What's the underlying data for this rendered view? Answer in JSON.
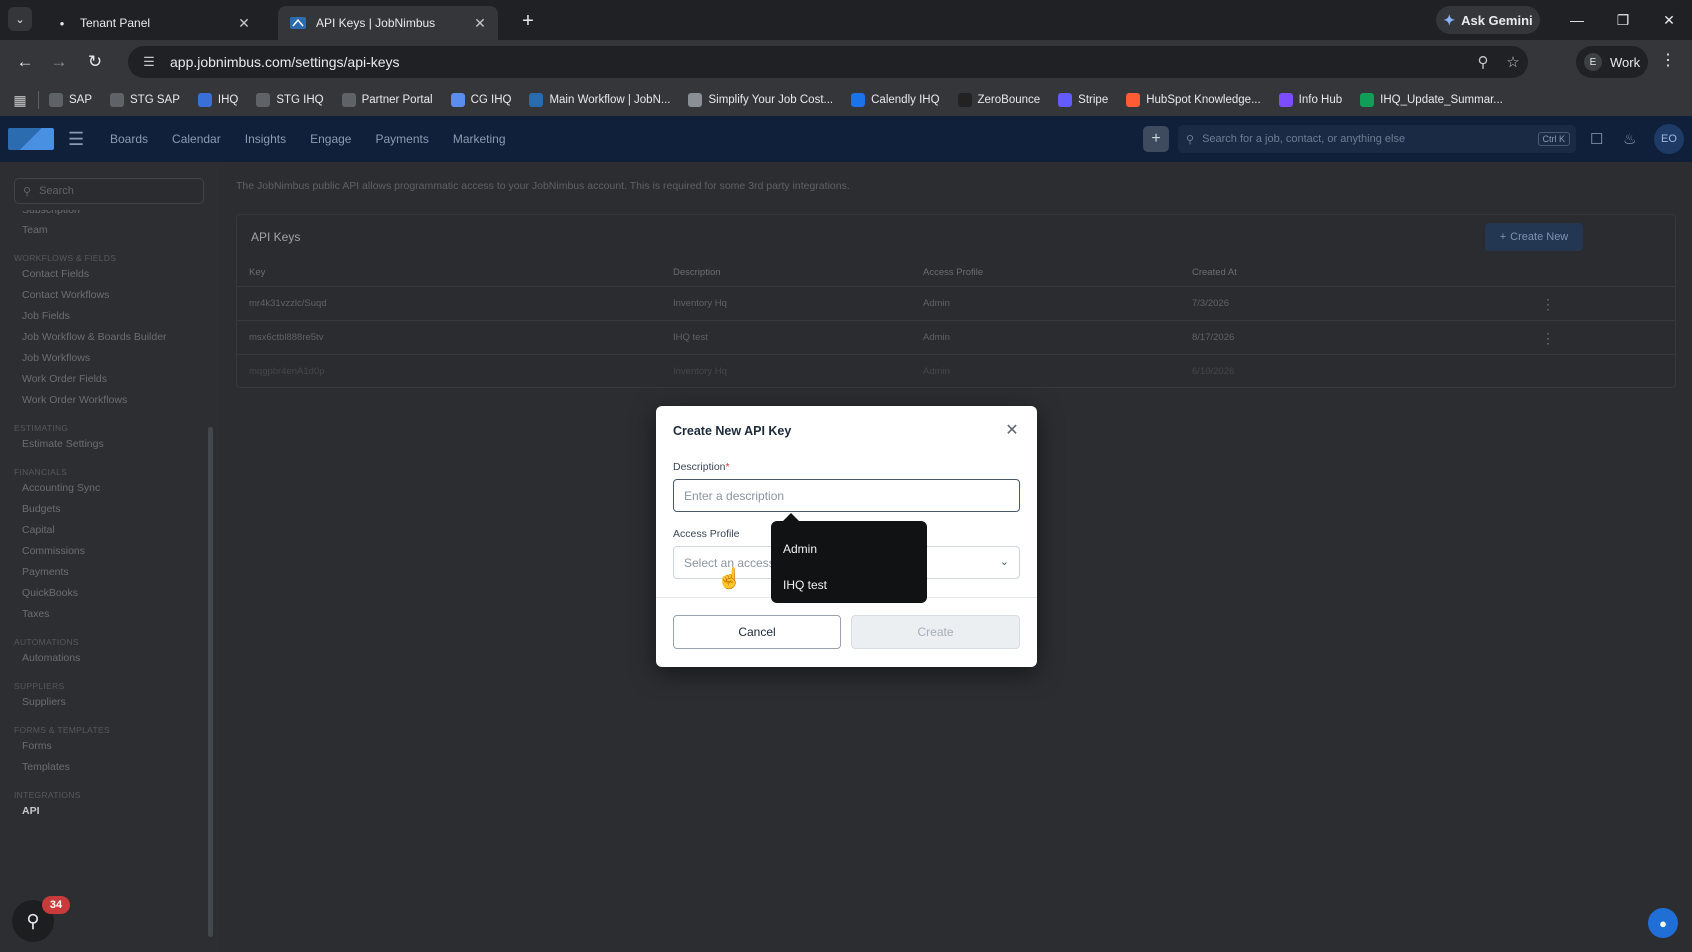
{
  "browser": {
    "tabs": [
      {
        "title": "Tenant Panel",
        "active": false
      },
      {
        "title": "API Keys | JobNimbus",
        "active": true
      }
    ],
    "ask_gemini": "Ask Gemini",
    "url": "app.jobnimbus.com/settings/api-keys",
    "profile": {
      "initial": "E",
      "name": "Work"
    },
    "bookmarks": [
      {
        "label": "SAP",
        "icon": "link-icon",
        "color": "#5f6368"
      },
      {
        "label": "STG SAP",
        "icon": "link-icon",
        "color": "#5f6368"
      },
      {
        "label": "IHQ",
        "icon": "house-icon",
        "color": "#3b6fd8"
      },
      {
        "label": "STG IHQ",
        "icon": "link-icon",
        "color": "#5f6368"
      },
      {
        "label": "Partner Portal",
        "icon": "link-icon",
        "color": "#5f6368"
      },
      {
        "label": "CG IHQ",
        "icon": "globe-icon",
        "color": "#5b8def"
      },
      {
        "label": "Main Workflow | JobN...",
        "icon": "jobnimbus-icon",
        "color": "#2b6cb0"
      },
      {
        "label": "Simplify Your Job Cost...",
        "icon": "globe-icon",
        "color": "#8a8f95"
      },
      {
        "label": "Calendly IHQ",
        "icon": "calendly-icon",
        "color": "#1a73e8"
      },
      {
        "label": "ZeroBounce",
        "icon": "zb-icon",
        "color": "#222222"
      },
      {
        "label": "Stripe",
        "icon": "stripe-icon",
        "color": "#635bff"
      },
      {
        "label": "HubSpot Knowledge...",
        "icon": "hubspot-icon",
        "color": "#ff5c35"
      },
      {
        "label": "Info Hub",
        "icon": "g-icon",
        "color": "#7c4dff"
      },
      {
        "label": "IHQ_Update_Summar...",
        "icon": "sheets-icon",
        "color": "#0f9d58"
      }
    ]
  },
  "app": {
    "nav": [
      "Boards",
      "Calendar",
      "Insights",
      "Engage",
      "Payments",
      "Marketing"
    ],
    "search_placeholder": "Search for a job, contact, or anything else",
    "search_shortcut": "Ctrl K",
    "user_initials": "EO"
  },
  "sidebar": {
    "search_placeholder": "Search",
    "truncated_top": "Subscription",
    "sections": [
      {
        "title": "",
        "items": [
          "Team"
        ]
      },
      {
        "title": "Workflows & Fields",
        "items": [
          "Contact Fields",
          "Contact Workflows",
          "Job Fields",
          "Job Workflow & Boards Builder",
          "Job Workflows",
          "Work Order Fields",
          "Work Order Workflows"
        ]
      },
      {
        "title": "Estimating",
        "items": [
          "Estimate Settings"
        ]
      },
      {
        "title": "Financials",
        "items": [
          "Accounting Sync",
          "Budgets",
          "Capital",
          "Commissions",
          "Payments",
          "QuickBooks",
          "Taxes"
        ]
      },
      {
        "title": "Automations",
        "items": [
          "Automations"
        ]
      },
      {
        "title": "Suppliers",
        "items": [
          "Suppliers"
        ]
      },
      {
        "title": "Forms & Templates",
        "items": [
          "Forms",
          "Templates"
        ]
      },
      {
        "title": "Integrations",
        "items": [
          "API"
        ]
      }
    ],
    "active_item": "API",
    "help_badge": "34"
  },
  "main": {
    "intro": "The JobNimbus public API allows programmatic access to your JobNimbus account. This is required for some 3rd party integrations.",
    "card_title": "API Keys",
    "create_new": "Create New",
    "columns": [
      "Key",
      "Description",
      "Access Profile",
      "Created At"
    ],
    "rows": [
      {
        "key": "mr4k31vzzlc/Suqd",
        "description": "Inventory Hq",
        "profile": "Admin",
        "created": "7/3/2026"
      },
      {
        "key": "msx6ctbl888re5tv",
        "description": "IHQ test",
        "profile": "Admin",
        "created": "8/17/2026"
      },
      {
        "key": "mqgpbr4enA1d0p",
        "description": "Inventory Hq",
        "profile": "Admin",
        "created": "6/10/2026"
      }
    ]
  },
  "modal": {
    "title": "Create New API Key",
    "description_label": "Description",
    "required_mark": "*",
    "description_placeholder": "Enter a description",
    "profile_label": "Access Profile",
    "profile_placeholder": "Select an access",
    "cancel": "Cancel",
    "create": "Create",
    "dropdown_options": [
      "Admin",
      "IHQ test"
    ]
  }
}
